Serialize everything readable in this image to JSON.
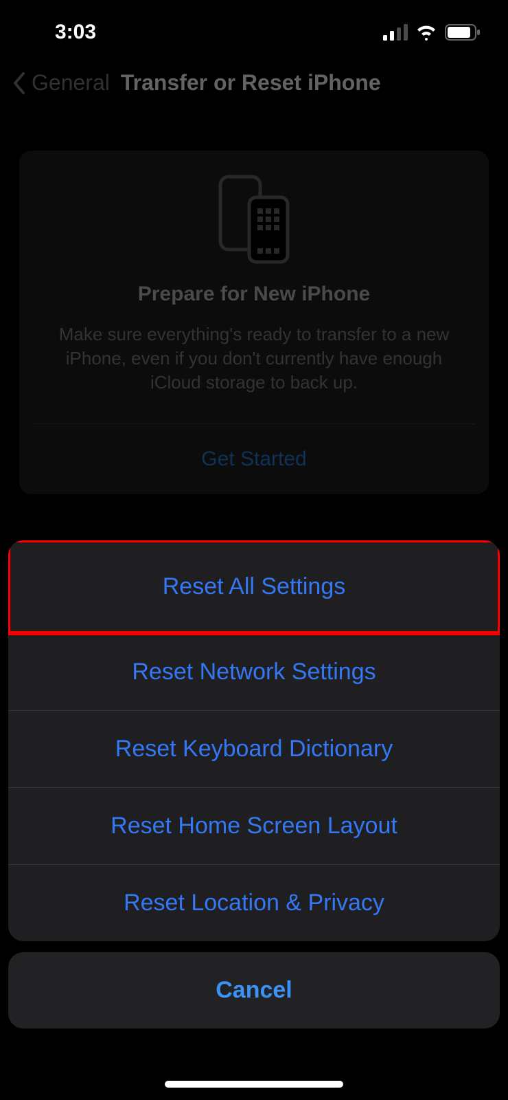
{
  "status": {
    "time": "3:03"
  },
  "nav": {
    "back_label": "General",
    "title": "Transfer or Reset iPhone"
  },
  "prepare_card": {
    "title": "Prepare for New iPhone",
    "description": "Make sure everything's ready to transfer to a new iPhone, even if you don't currently have enough iCloud storage to back up.",
    "cta": "Get Started"
  },
  "sheet": {
    "items": [
      "Reset All Settings",
      "Reset Network Settings",
      "Reset Keyboard Dictionary",
      "Reset Home Screen Layout",
      "Reset Location & Privacy"
    ],
    "cancel": "Cancel"
  }
}
